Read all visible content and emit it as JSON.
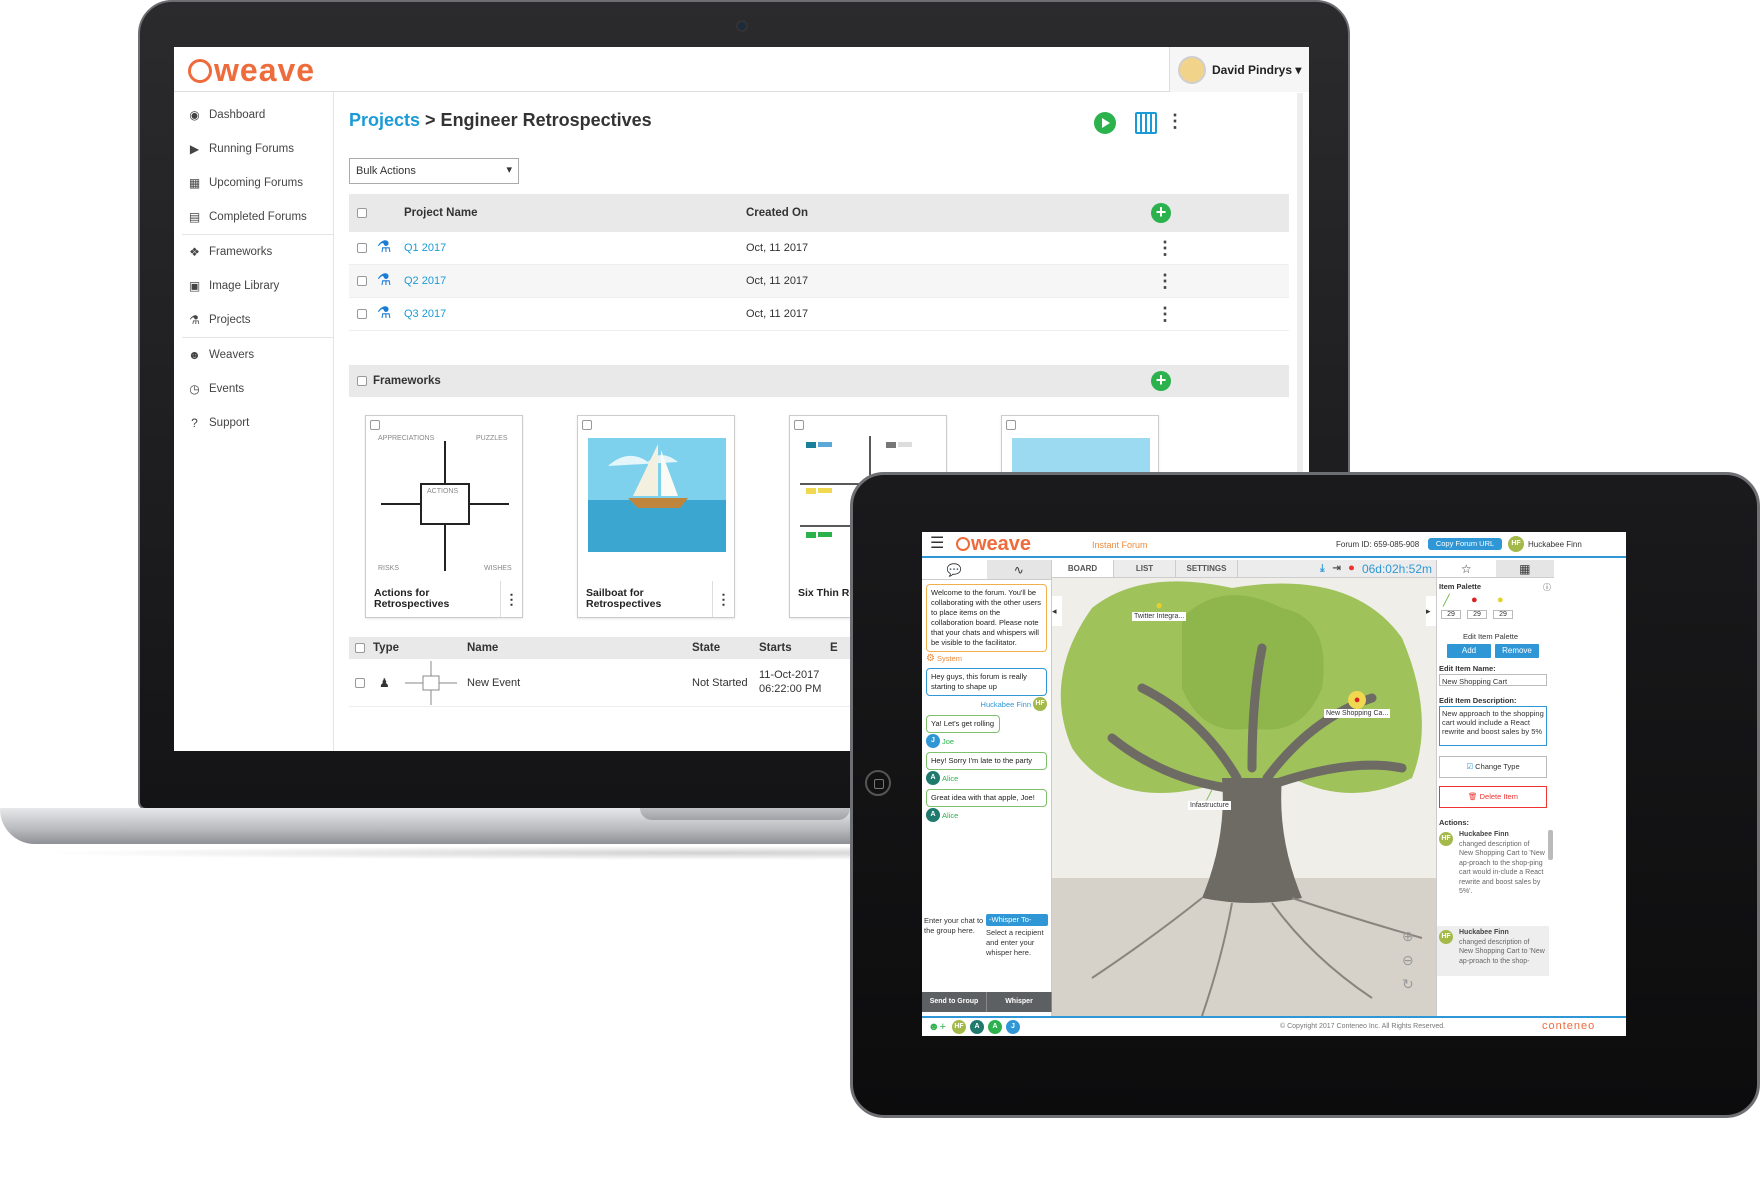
{
  "laptop": {
    "logo": "weave",
    "user_name": "David Pindrys ▾",
    "sidebar": [
      {
        "label": "Dashboard",
        "icon": "dashboard-icon",
        "glyph": "◉"
      },
      {
        "label": "Running Forums",
        "icon": "play-circle-icon",
        "glyph": "▶"
      },
      {
        "label": "Upcoming Forums",
        "icon": "calendar-icon",
        "glyph": "▦"
      },
      {
        "label": "Completed Forums",
        "icon": "document-icon",
        "glyph": "▤"
      },
      {
        "label": "Frameworks",
        "icon": "cubes-icon",
        "glyph": "❖"
      },
      {
        "label": "Image Library",
        "icon": "image-icon",
        "glyph": "▣"
      },
      {
        "label": "Projects",
        "icon": "flask-icon",
        "glyph": "⚗"
      },
      {
        "label": "Weavers",
        "icon": "users-icon",
        "glyph": "☻"
      },
      {
        "label": "Events",
        "icon": "clock-icon",
        "glyph": "◷"
      },
      {
        "label": "Support",
        "icon": "question-icon",
        "glyph": "?"
      }
    ],
    "breadcrumb_link": "Projects",
    "breadcrumb_current": " > Engineer Retrospectives",
    "bulk_actions": "Bulk Actions",
    "table_headers": {
      "name": "Project Name",
      "created": "Created On"
    },
    "projects": [
      {
        "name": "Q1 2017",
        "created": "Oct, 11 2017"
      },
      {
        "name": "Q2 2017",
        "created": "Oct, 11 2017"
      },
      {
        "name": "Q3 2017",
        "created": "Oct, 11 2017"
      }
    ],
    "frameworks_header": "Frameworks",
    "frameworks": [
      {
        "label": "Actions for Retrospectives",
        "quad": [
          "APPRECIATIONS",
          "PUZZLES",
          "RISKS",
          "WISHES"
        ],
        "center": "ACTIONS"
      },
      {
        "label": "Sailboat for Retrospectives"
      },
      {
        "label": "Six Thin Retrosp"
      },
      {
        "label": ""
      }
    ],
    "events_headers": {
      "type": "Type",
      "name": "Name",
      "state": "State",
      "starts": "Starts",
      "ends": "E"
    },
    "events": [
      {
        "name": "New Event",
        "state": "Not Started",
        "starts_date": "11-Oct-2017",
        "starts_time": "06:22:00 PM"
      }
    ]
  },
  "tablet": {
    "logo": "weave",
    "forum_type": "Instant Forum",
    "forum_id": "Forum ID: 659-085-908",
    "copy_url": "Copy Forum URL",
    "user_initials": "HF",
    "user_name": "Huckabee Finn",
    "timer": "06d:02h:52m",
    "board_tabs": [
      "BOARD",
      "LIST",
      "SETTINGS"
    ],
    "chat": [
      {
        "text": "Welcome to the forum. You'll be collaborating with the other users to place items on the collaboration board. Please note that your chats and whispers will be visible to the facilitator.",
        "who": "System",
        "initials": "",
        "type": "sys"
      },
      {
        "text": "Hey guys, this forum is really starting to shape up",
        "who": "Huckabee Finn",
        "initials": "HF",
        "type": "me"
      },
      {
        "text": "Ya! Let's get rolling",
        "who": "Joe",
        "initials": "J",
        "type": "j"
      },
      {
        "text": "Hey! Sorry I'm late to the party",
        "who": "Alice",
        "initials": "A",
        "type": "a"
      },
      {
        "text": "Great idea with that apple, Joe!",
        "who": "Alice",
        "initials": "A",
        "type": "a"
      }
    ],
    "compose_placeholder": "Enter your chat to the group here.",
    "whisper_select": "-Whisper To-",
    "whisper_hint": "Select a recipient and enter your whisper here.",
    "send_group": "Send to Group",
    "whisper_btn": "Whisper",
    "board_items": [
      {
        "label": "Twitter Integra..."
      },
      {
        "label": "New Shopping Ca..."
      },
      {
        "label": "Infastructure"
      }
    ],
    "palette_title": "Item Palette",
    "palette_counts": [
      "29",
      "29",
      "29"
    ],
    "edit_palette": "Edit Item Palette",
    "add": "Add",
    "remove": "Remove",
    "edit_name_label": "Edit Item Name:",
    "edit_name_value": "New Shopping Cart",
    "edit_desc_label": "Edit Item Description:",
    "edit_desc_value": "New approach to the shopping cart would include a React rewrite and boost sales by 5%",
    "change_type": "Change Type",
    "delete_item": "Delete Item",
    "actions_label": "Actions:",
    "actions": [
      {
        "who": "Huckabee Finn",
        "text": "changed description of New Shopping Cart to 'New ap-proach to the shop-ping cart would in-clude a React rewrite and boost sales by 5%'."
      },
      {
        "who": "Huckabee Finn",
        "text": "changed description of New Shopping Cart to 'New ap-proach to the shop-"
      }
    ],
    "footer_avatars": [
      "HF",
      "A",
      "A",
      "J"
    ],
    "copyright": "© Copyright 2017 Conteneo Inc. All Rights Reserved.",
    "brand": "conteneo"
  }
}
